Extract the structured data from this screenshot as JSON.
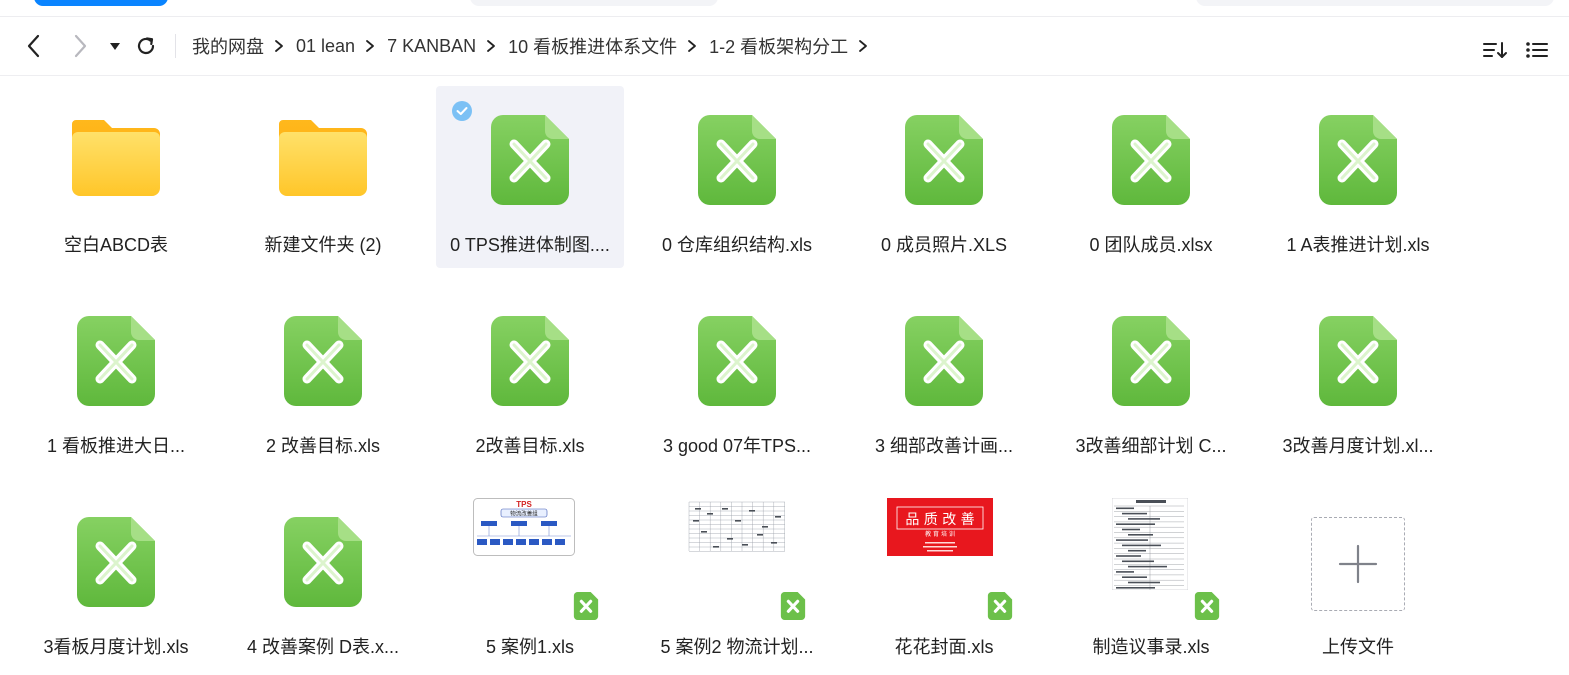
{
  "breadcrumb": [
    "我的网盘",
    "01 lean",
    "7 KANBAN",
    "10 看板推进体系文件",
    "1-2 看板架构分工"
  ],
  "colors": {
    "accent": "#0a84ff",
    "excel_green": "#6cc04a",
    "folder_yellow": "#ffc629",
    "selected_bg": "#f1f2f8",
    "check_blue": "#7cc1f5"
  },
  "items": [
    {
      "label": "空白ABCD表",
      "type": "folder"
    },
    {
      "label": "新建文件夹 (2)",
      "type": "folder"
    },
    {
      "label": "0 TPS推进体制图....",
      "type": "excel",
      "selected": true
    },
    {
      "label": "0 仓库组织结构.xls",
      "type": "excel"
    },
    {
      "label": "0 成员照片.XLS",
      "type": "excel"
    },
    {
      "label": "0 团队成员.xlsx",
      "type": "excel"
    },
    {
      "label": "1 A表推进计划.xls",
      "type": "excel"
    },
    {
      "label": "1 看板推进大日...",
      "type": "excel"
    },
    {
      "label": "2 改善目标.xls",
      "type": "excel"
    },
    {
      "label": "2改善目标.xls",
      "type": "excel"
    },
    {
      "label": "3 good 07年TPS...",
      "type": "excel"
    },
    {
      "label": "3 细部改善计画...",
      "type": "excel"
    },
    {
      "label": "3改善细部计划 C...",
      "type": "excel"
    },
    {
      "label": "3改善月度计划.xl...",
      "type": "excel"
    },
    {
      "label": "3看板月度计划.xls",
      "type": "excel"
    },
    {
      "label": "4 改善案例 D表.x...",
      "type": "excel"
    },
    {
      "label": "5 案例1.xls",
      "type": "thumb-tps",
      "thumb_title": "TPS",
      "thumb_sub": "物流改善组"
    },
    {
      "label": "5 案例2 物流计划...",
      "type": "thumb-table"
    },
    {
      "label": "花花封面.xls",
      "type": "thumb-red",
      "thumb_title": "品 质 改 善",
      "thumb_sub": "教 育 培 训"
    },
    {
      "label": "制造议事录.xls",
      "type": "thumb-doc"
    },
    {
      "label": "上传文件",
      "type": "upload"
    }
  ]
}
